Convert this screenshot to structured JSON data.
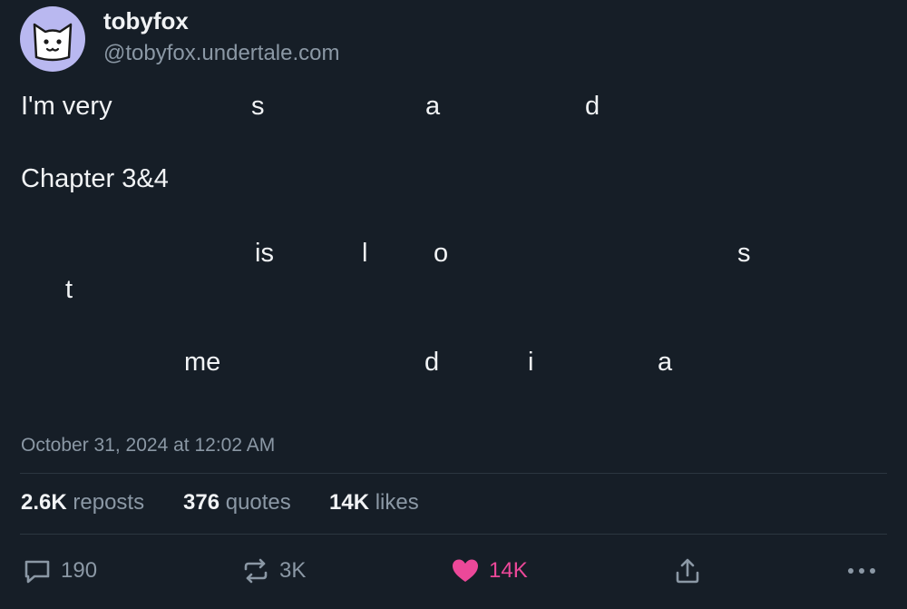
{
  "author": {
    "display_name": "tobyfox",
    "handle": "@tobyfox.undertale.com",
    "avatar_icon": "cat-face-icon",
    "avatar_bg": "#b9b8f0"
  },
  "post": {
    "line1": {
      "w0": "I'm very",
      "w1": "s",
      "w2": "a",
      "w3": "d"
    },
    "line2": {
      "w0": "Chapter 3&4"
    },
    "line3": {
      "w0": "is",
      "w1": "l",
      "w2": "o",
      "w3": "s"
    },
    "line4": {
      "w0": "t"
    },
    "line5": {
      "w0": "me",
      "w1": "d",
      "w2": "i",
      "w3": "a"
    }
  },
  "timestamp": "October 31, 2024 at 12:02 AM",
  "stats": {
    "reposts_count": "2.6K",
    "reposts_label": "reposts",
    "quotes_count": "376",
    "quotes_label": "quotes",
    "likes_count": "14K",
    "likes_label": "likes"
  },
  "actions": {
    "reply": {
      "icon": "reply-icon",
      "count": "190"
    },
    "repost": {
      "icon": "repost-icon",
      "count": "3K"
    },
    "like": {
      "icon": "heart-icon",
      "count": "14K",
      "color": "#ec4899"
    },
    "share": {
      "icon": "share-icon"
    },
    "menu": {
      "icon": "more-options-icon"
    }
  }
}
